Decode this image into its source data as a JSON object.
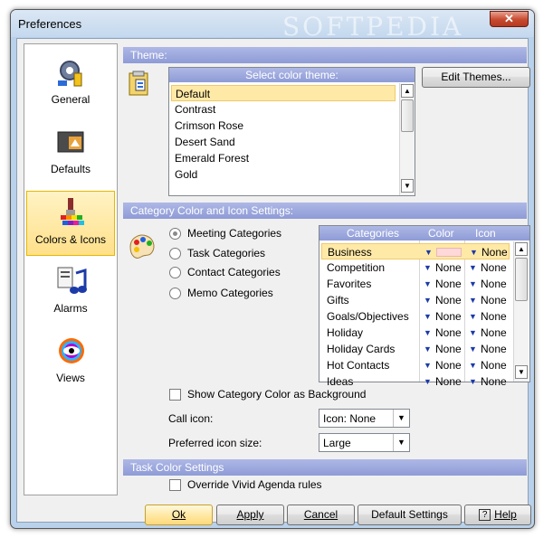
{
  "window": {
    "title": "Preferences",
    "watermark": "SOFTPEDIA",
    "close_glyph": "✕"
  },
  "sidebar": {
    "items": [
      {
        "label": "General",
        "icon": "gear-icon"
      },
      {
        "label": "Defaults",
        "icon": "folder-defaults-icon"
      },
      {
        "label": "Colors & Icons",
        "icon": "paintbrush-icon",
        "selected": true
      },
      {
        "label": "Alarms",
        "icon": "alarm-music-icon"
      },
      {
        "label": "Views",
        "icon": "eye-views-icon"
      }
    ]
  },
  "theme": {
    "section_label": "Theme:",
    "list_header": "Select color theme:",
    "items": [
      "Default",
      "Contrast",
      "Crimson Rose",
      "Desert Sand",
      "Emerald Forest",
      "Gold"
    ],
    "selected": "Default",
    "edit_button": "Edit Themes..."
  },
  "category": {
    "section_label": "Category Color and Icon Settings:",
    "radios": [
      {
        "label": "Meeting Categories",
        "checked": true
      },
      {
        "label": "Task Categories",
        "checked": false
      },
      {
        "label": "Contact Categories",
        "checked": false
      },
      {
        "label": "Memo Categories",
        "checked": false
      }
    ],
    "table": {
      "columns": [
        "Categories",
        "Color",
        "Icon"
      ],
      "rows": [
        {
          "name": "Business",
          "color": "",
          "icon": "None",
          "selected": true
        },
        {
          "name": "Competition",
          "color": "None",
          "icon": "None"
        },
        {
          "name": "Favorites",
          "color": "None",
          "icon": "None"
        },
        {
          "name": "Gifts",
          "color": "None",
          "icon": "None"
        },
        {
          "name": "Goals/Objectives",
          "color": "None",
          "icon": "None"
        },
        {
          "name": "Holiday",
          "color": "None",
          "icon": "None"
        },
        {
          "name": "Holiday Cards",
          "color": "None",
          "icon": "None"
        },
        {
          "name": "Hot Contacts",
          "color": "None",
          "icon": "None"
        },
        {
          "name": "Ideas",
          "color": "None",
          "icon": "None"
        }
      ]
    },
    "show_category_color_label": "Show Category Color as Background",
    "call_icon_label": "Call icon:",
    "call_icon_value": "Icon: None",
    "preferred_size_label": "Preferred icon size:",
    "preferred_size_value": "Large"
  },
  "task_color": {
    "section_label": "Task Color Settings",
    "override_label": "Override Vivid Agenda rules"
  },
  "buttons": {
    "ok": "Ok",
    "apply": "Apply",
    "cancel": "Cancel",
    "default_settings": "Default Settings",
    "help": "Help"
  },
  "colors": {
    "accent": "#8e9bd6",
    "selection": "#ffe9a6",
    "swatch_business": "#ffd8d8"
  }
}
